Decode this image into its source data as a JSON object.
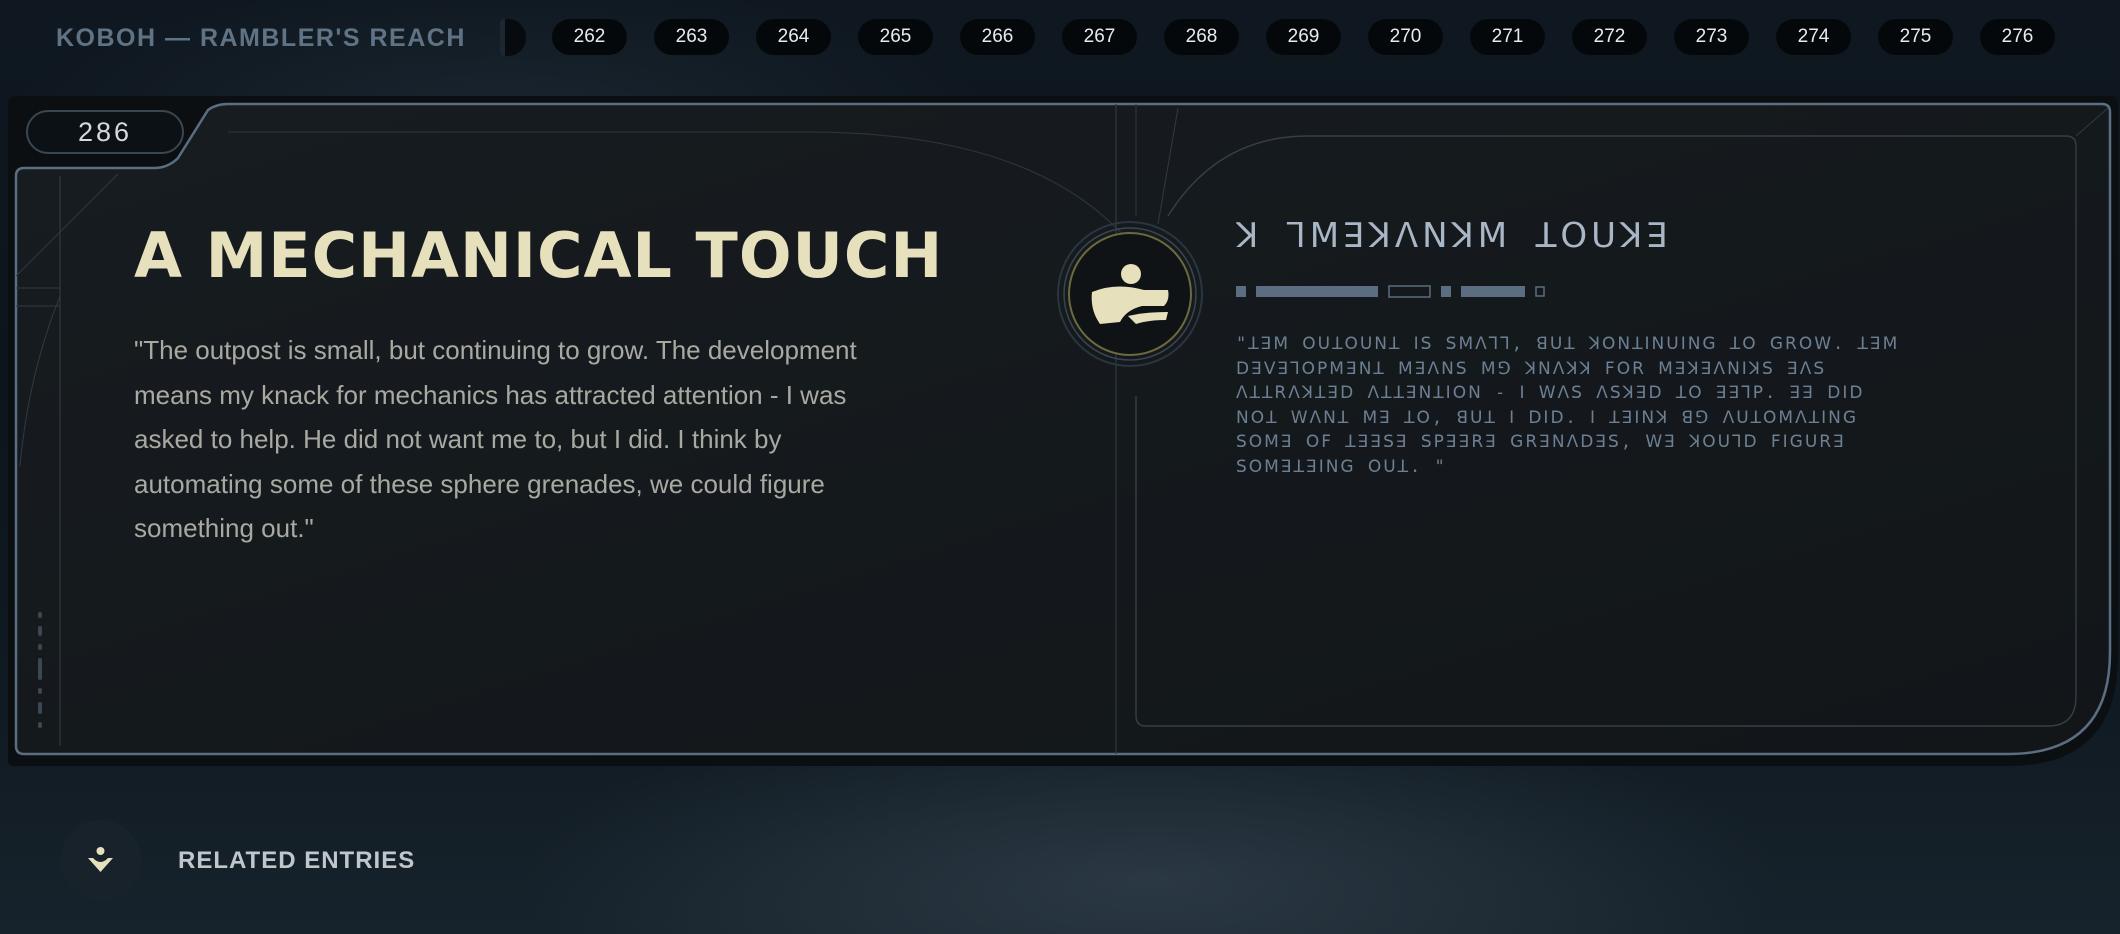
{
  "header": {
    "location": "KOBOH — RAMBLER'S REACH",
    "pages": [
      "262",
      "263",
      "264",
      "265",
      "266",
      "267",
      "268",
      "269",
      "270",
      "271",
      "272",
      "273",
      "274",
      "275",
      "276"
    ]
  },
  "entry": {
    "number": "286",
    "title": "A MECHANICAL TOUCH",
    "quote": "\"The outpost is small, but continuing to grow. The development means my knack for mechanics has attracted attention - I was asked to help. He did not want me to, but I did. I think by automating some of these sphere grenades, we could figure something out.\"",
    "emblem_icon": "landspeeder-icon",
    "aurebesh_title": "ꓘ ꓶꓟꓱꓘꓥꓠꓘꓟ ꓕꓳꓴꓘꓱ",
    "aurebesh_lines": [
      "\"ꓕꓱꓟ ꓳꓴꓕꓳꓴꓠꓕ ꓲꓢ ꓢꓟꓥꓶꓶ, ꓭꓴꓕ ꓘꓳꓠꓕꓲꓠꓴꓲꓠꓖ ꓕꓳ ꓖꓣꓳꓪ. ꓕꓱꓟ",
      "ꓓꓱꓦꓱꓶꓳꓑꓟꓱꓠꓕ ꓟꓱꓥꓠꓢ ꓟꓨ ꓘꓠꓥꓘꓘ ꓝꓳꓣ ꓟꓱꓘꓱꓥꓠꓲꓘꓢ ꓱꓥꓢ",
      "ꓥꓕꓕꓣꓥꓘꓕꓱꓓ ꓥꓕꓕꓱꓠꓕꓲꓳꓠ - ꓲ ꓪꓥꓢ ꓥꓢꓘꓱꓓ ꓕꓳ ꓱꓱꓶꓑ. ꓱꓱ ꓓꓲꓓ",
      "ꓠꓳꓕ ꓪꓥꓠꓕ ꓟꓱ ꓕꓳ, ꓭꓴꓕ ꓲ ꓓꓲꓓ. ꓲ ꓕꓱꓲꓠꓘ ꓭꓨ ꓥꓴꓕꓳꓟꓥꓕꓲꓠꓖ",
      "ꓢꓳꓟꓱ ꓳꓝ ꓕꓱꓱꓢꓱ ꓢꓑꓱꓱꓣꓱ ꓖꓣꓱꓠꓥꓓꓱꓢ, ꓪꓱ ꓘꓳꓴꓶꓓ ꓝꓲꓖꓴꓣꓱ",
      "ꓢꓳꓟꓱꓕꓱꓲꓠꓖ ꓳꓴꓕ. \""
    ]
  },
  "related": {
    "label": "RELATED ENTRIES",
    "icon": "person-marker-icon"
  },
  "colors": {
    "title": "#e6e0bd",
    "accent_frame": "#5b6d80",
    "aurebesh": "#6c7f93",
    "panel_bg": "#14191d"
  }
}
